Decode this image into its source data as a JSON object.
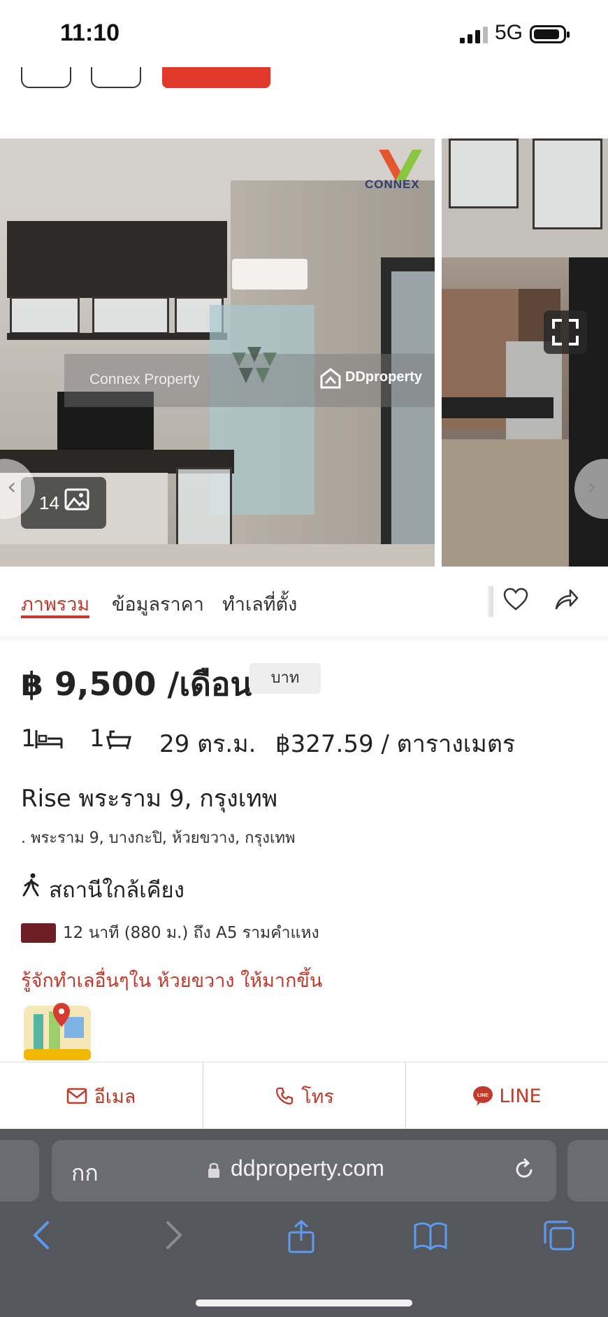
{
  "status_bar": {
    "time": "11:10",
    "network": "5G"
  },
  "gallery": {
    "watermark_connex": "Connex Property",
    "watermark_dd": "DDproperty",
    "logo_text": "CONNEX",
    "photo_count": "14"
  },
  "tabs": [
    {
      "label": "ภาพรวม",
      "active": true
    },
    {
      "label": "ข้อมูลราคา",
      "active": false
    },
    {
      "label": "ทำเลที่ตั้ง",
      "active": false
    }
  ],
  "listing": {
    "price": "฿ 9,500 /เดือน",
    "price_unit": "บาท",
    "bedrooms": "1",
    "bathrooms": "1",
    "area": "29 ตร.ม.",
    "price_per_sqm": "฿327.59 / ตารางเมตร",
    "title": "Rise พระราม 9, กรุงเทพ",
    "address": ". พระราม 9, บางกะปิ, ห้วยขวาง, กรุงเทพ"
  },
  "nearby": {
    "heading": "สถานีใกล้เคียง",
    "stations": [
      {
        "text": "12 นาที (880 ม.) ถึง A5 รามคำแหง",
        "line_color": "#6e1f25"
      }
    ],
    "explore_link": "รู้จักทำเลอื่นๆใน ห้วยขวาง ให้มากขึ้น"
  },
  "contact": {
    "email_label": "อีเมล",
    "call_label": "โทร",
    "line_label": "LINE"
  },
  "browser": {
    "aa_label": "กก",
    "url": "ddproperty.com"
  },
  "colors": {
    "accent": "#c0392b",
    "browser_chrome": "#56575c"
  }
}
